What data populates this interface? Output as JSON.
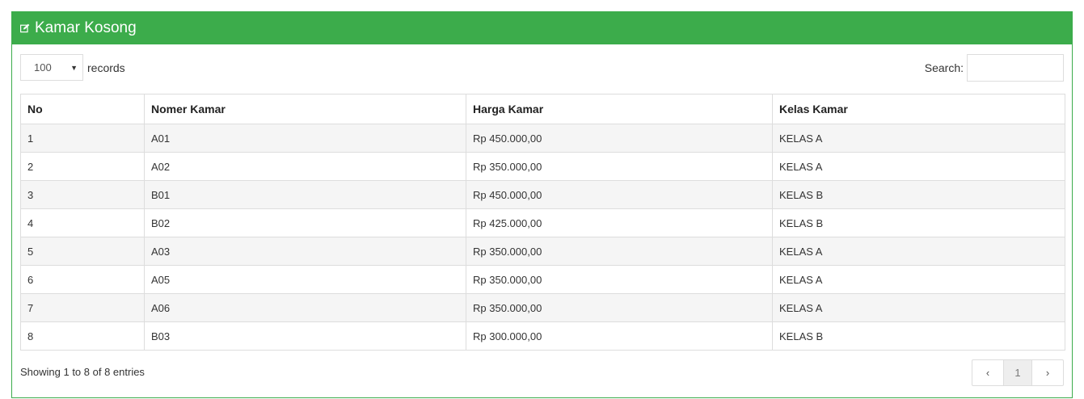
{
  "panel": {
    "title": "Kamar Kosong"
  },
  "controls": {
    "length_value": "100",
    "records_label": "records",
    "search_label": "Search:",
    "search_value": ""
  },
  "table": {
    "headers": [
      "No",
      "Nomer Kamar",
      "Harga Kamar",
      "Kelas Kamar"
    ],
    "rows": [
      [
        "1",
        "A01",
        "Rp 450.000,00",
        "KELAS A"
      ],
      [
        "2",
        "A02",
        "Rp 350.000,00",
        "KELAS A"
      ],
      [
        "3",
        "B01",
        "Rp 450.000,00",
        "KELAS B"
      ],
      [
        "4",
        "B02",
        "Rp 425.000,00",
        "KELAS B"
      ],
      [
        "5",
        "A03",
        "Rp 350.000,00",
        "KELAS A"
      ],
      [
        "6",
        "A05",
        "Rp 350.000,00",
        "KELAS A"
      ],
      [
        "7",
        "A06",
        "Rp 350.000,00",
        "KELAS A"
      ],
      [
        "8",
        "B03",
        "Rp 300.000,00",
        "KELAS B"
      ]
    ]
  },
  "footer": {
    "info": "Showing 1 to 8 of 8 entries",
    "prev": "‹",
    "page": "1",
    "next": "›"
  },
  "colors": {
    "accent": "#3cac4b"
  },
  "icons": {
    "title_icon": "edit-icon"
  }
}
